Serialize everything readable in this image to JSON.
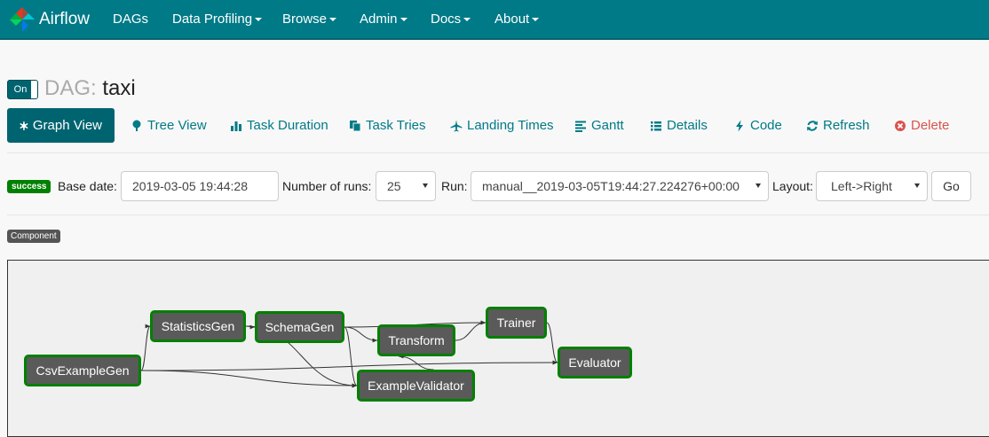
{
  "navbar": {
    "brand": "Airflow",
    "items": [
      {
        "label": "DAGs",
        "dropdown": false
      },
      {
        "label": "Data Profiling",
        "dropdown": true
      },
      {
        "label": "Browse",
        "dropdown": true
      },
      {
        "label": "Admin",
        "dropdown": true
      },
      {
        "label": "Docs",
        "dropdown": true
      },
      {
        "label": "About",
        "dropdown": true
      }
    ]
  },
  "dag": {
    "toggle_label": "On",
    "title_prefix": "DAG:",
    "name": "taxi"
  },
  "tabs": [
    {
      "label": "Graph View",
      "icon": "asterisk-icon",
      "active": true
    },
    {
      "label": "Tree View",
      "icon": "tree-icon"
    },
    {
      "label": "Task Duration",
      "icon": "bar-chart-icon"
    },
    {
      "label": "Task Tries",
      "icon": "duplicate-icon"
    },
    {
      "label": "Landing Times",
      "icon": "plane-icon"
    },
    {
      "label": "Gantt",
      "icon": "align-left-icon"
    },
    {
      "label": "Details",
      "icon": "list-icon"
    },
    {
      "label": "Code",
      "icon": "flash-icon"
    },
    {
      "label": "Refresh",
      "icon": "refresh-icon"
    },
    {
      "label": "Delete",
      "icon": "remove-circle-icon",
      "danger": true
    }
  ],
  "controls": {
    "status_badge": "success",
    "base_date_label": "Base date:",
    "base_date_value": "2019-03-05 19:44:28",
    "num_runs_label": "Number of runs:",
    "num_runs_value": "25",
    "run_label": "Run:",
    "run_value": "manual__2019-03-05T19:44:27.224276+00:00",
    "layout_label": "Layout:",
    "layout_value": "Left->Right",
    "go_label": "Go"
  },
  "legend": {
    "component_badge": "Component"
  },
  "graph": {
    "nodes": [
      {
        "id": "csv",
        "label": "CsvExampleGen"
      },
      {
        "id": "stats",
        "label": "StatisticsGen"
      },
      {
        "id": "schema",
        "label": "SchemaGen"
      },
      {
        "id": "transform",
        "label": "Transform"
      },
      {
        "id": "trainer",
        "label": "Trainer"
      },
      {
        "id": "validator",
        "label": "ExampleValidator"
      },
      {
        "id": "evaluator",
        "label": "Evaluator"
      }
    ],
    "edges": [
      [
        "csv",
        "stats"
      ],
      [
        "csv",
        "validator"
      ],
      [
        "csv",
        "evaluator"
      ],
      [
        "stats",
        "schema"
      ],
      [
        "stats",
        "validator"
      ],
      [
        "schema",
        "transform"
      ],
      [
        "schema",
        "validator"
      ],
      [
        "schema",
        "trainer"
      ],
      [
        "validator",
        "transform"
      ],
      [
        "transform",
        "trainer"
      ],
      [
        "trainer",
        "evaluator"
      ]
    ],
    "node_border_color": "#008000",
    "node_fill_color": "#5a5a5a"
  }
}
